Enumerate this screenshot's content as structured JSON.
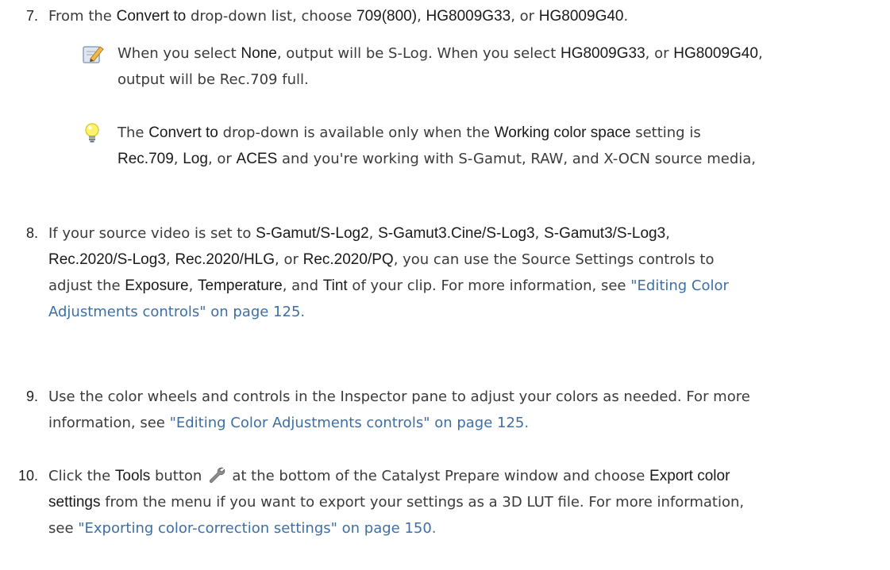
{
  "step7": {
    "num": "7.",
    "t1": "From the ",
    "convert_to": "Convert to",
    "t2": " drop-down list, choose ",
    "opt1": "709(800)",
    "sep1": ", ",
    "opt2": "HG8009G33",
    "sep2": ", or ",
    "opt3": "HG8009G40",
    "end": "."
  },
  "note1": {
    "icon": "pencil-note-icon",
    "t1": "When you select ",
    "none": "None",
    "t2": ", output will be S-Log. When you select ",
    "opt2": "HG8009G33",
    "t3": ", or ",
    "opt3": "HG8009G40",
    "t4": ",",
    "line2": "output will be Rec.709 full."
  },
  "tip1": {
    "icon": "lightbulb-tip-icon",
    "t1": "The ",
    "convert_to": "Convert to",
    "t2": " drop-down is available only when the ",
    "wcs": "Working color space",
    "t3": " setting is",
    "rec709": "Rec.709",
    "sep1": ", ",
    "log": "Log",
    "sep2": ", or ",
    "aces": "ACES",
    "t4": " and you're working with S-Gamut, RAW, and X-OCN source media,"
  },
  "step8": {
    "num": "8.",
    "t1": "If your source video is set to ",
    "g1": "S-Gamut/S-Log2",
    "s1": ", ",
    "g2": "S-Gamut3.Cine/S-Log3",
    "s2": ", ",
    "g3": "S-Gamut3/S-Log3",
    "s3": ",",
    "g4": "Rec.2020/S-Log3",
    "s4": ", ",
    "g5": "Rec.2020/HLG",
    "s5": ", or ",
    "g6": "Rec.2020/PQ",
    "t2": ", you can use the Source Settings controls to",
    "t3": "adjust the ",
    "exposure": "Exposure",
    "s6": ", ",
    "temperature": "Temperature",
    "s7": ", and ",
    "tint": "Tint",
    "t4": " of your clip. For more information, see ",
    "link_a": "\"Editing Color",
    "link_b": "Adjustments controls\" on page 125."
  },
  "step9": {
    "num": "9.",
    "line1": "Use the color wheels and controls in the Inspector pane to adjust your colors as needed. For more",
    "t1": "information, see ",
    "link": "\"Editing Color Adjustments controls\" on page 125."
  },
  "step10": {
    "num": "10.",
    "t1": "Click the ",
    "tools": "Tools",
    "t2": " button",
    "icon": "wrench-icon",
    "t3": "at the bottom of the Catalyst Prepare window and choose ",
    "export_a": "Export color",
    "export_b": "settings",
    "t4": " from the menu if you want to export your settings as a 3D LUT file. For more information,",
    "t5": "see ",
    "link": "\"Exporting color-correction settings\" on page 150."
  }
}
